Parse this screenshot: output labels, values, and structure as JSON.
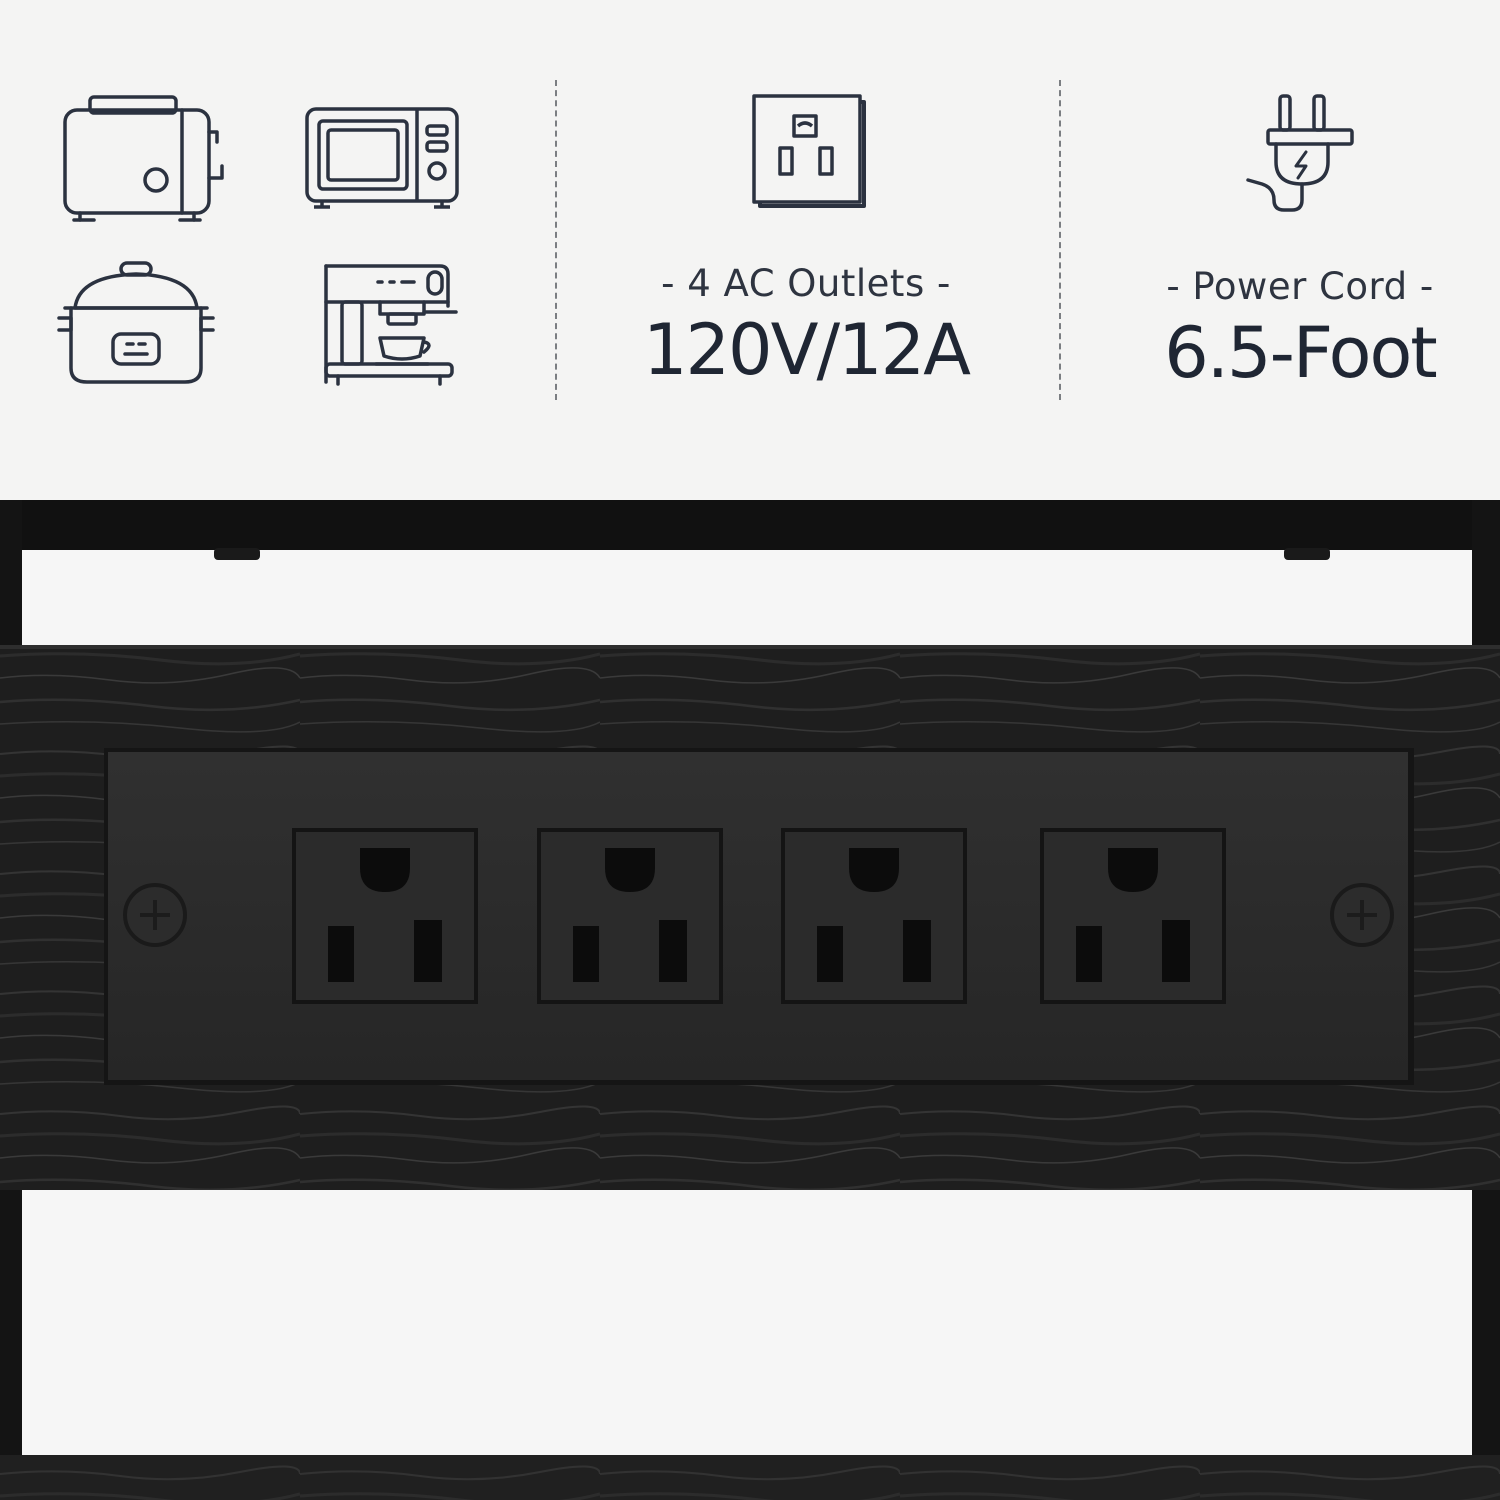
{
  "appliances": [
    {
      "name": "toaster-icon"
    },
    {
      "name": "microwave-icon"
    },
    {
      "name": "rice-cooker-icon"
    },
    {
      "name": "coffee-machine-icon"
    }
  ],
  "specs": {
    "outlets": {
      "label": "- 4 AC Outlets -",
      "value": "120V/12A",
      "icon": "ac-outlet-icon"
    },
    "cord": {
      "label": "- Power Cord -",
      "value": "6.5-Foot",
      "icon": "power-plug-icon"
    }
  },
  "colors": {
    "icon_stroke": "#2b3240",
    "text": "#1f2633",
    "background": "#f4f4f3",
    "frame": "#111111",
    "wood": "#1c1c1c",
    "outlet_panel": "#2a2a2a"
  },
  "photo": {
    "outlet_count": 4
  }
}
